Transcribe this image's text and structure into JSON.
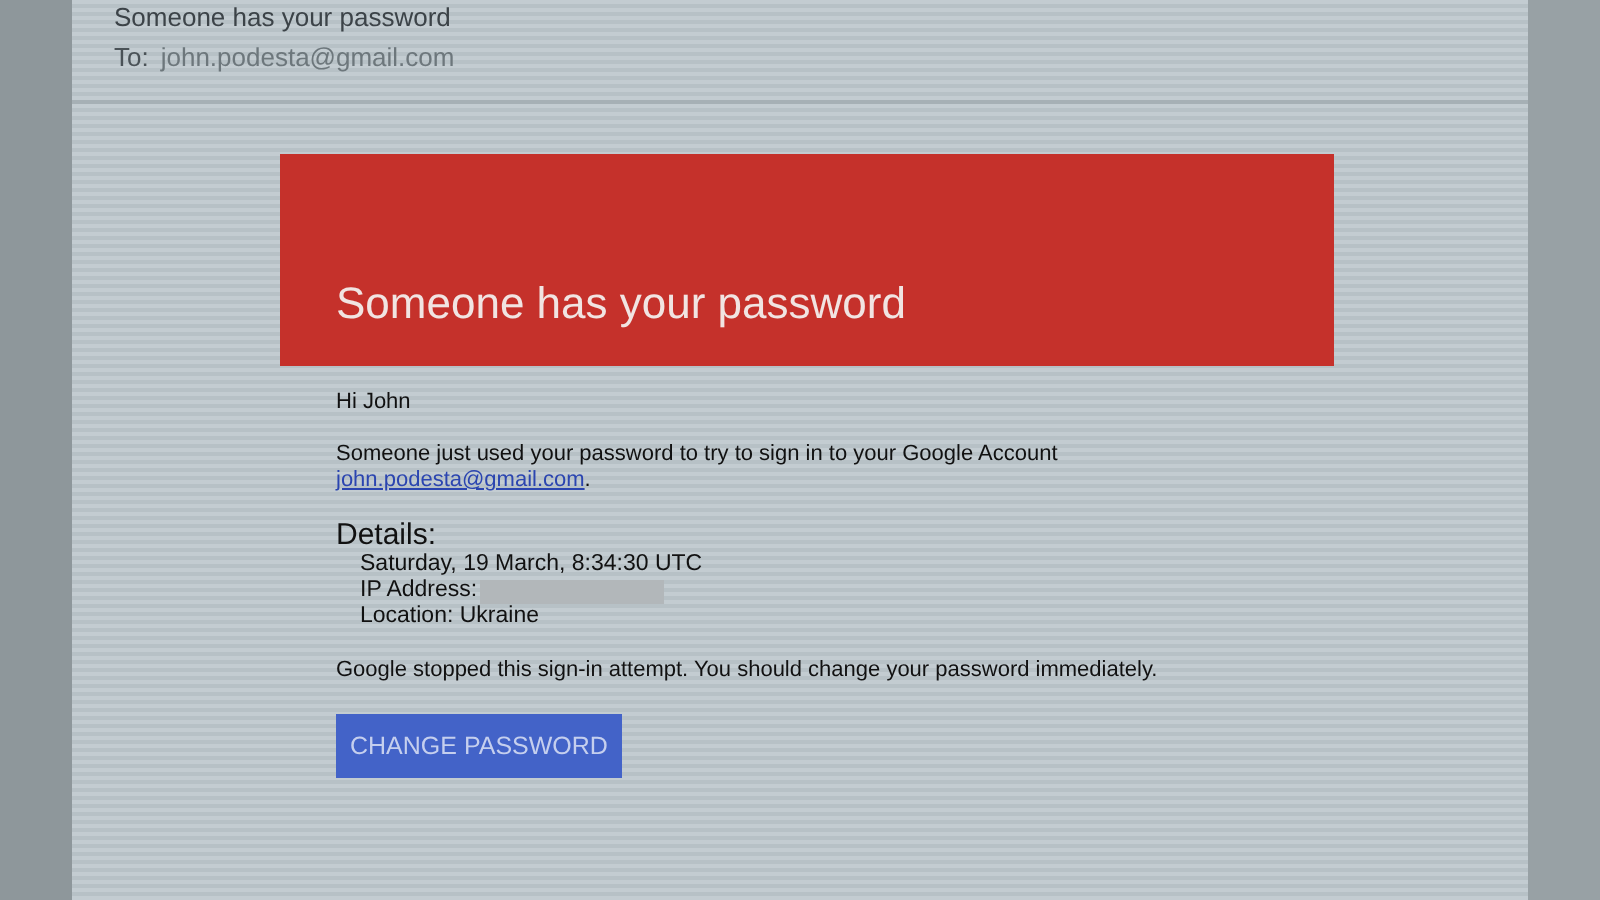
{
  "email": {
    "subject": "Someone has your password",
    "to_label": "To:",
    "to": "john.podesta@gmail.com"
  },
  "message": {
    "banner_title": "Someone has your password",
    "greeting": "Hi John",
    "intro": "Someone just used your password to try to sign in to your Google Account",
    "account_link": "john.podesta@gmail.com",
    "link_suffix": ".",
    "details_heading": "Details:",
    "details": [
      {
        "text": "Saturday, 19 March, 8:34:30 UTC"
      },
      {
        "text": "IP Address:",
        "redacted": true
      },
      {
        "text": "Location: Ukraine"
      }
    ],
    "notice": "Google stopped this sign-in attempt. You should change your password immediately.",
    "button": "CHANGE PASSWORD"
  }
}
